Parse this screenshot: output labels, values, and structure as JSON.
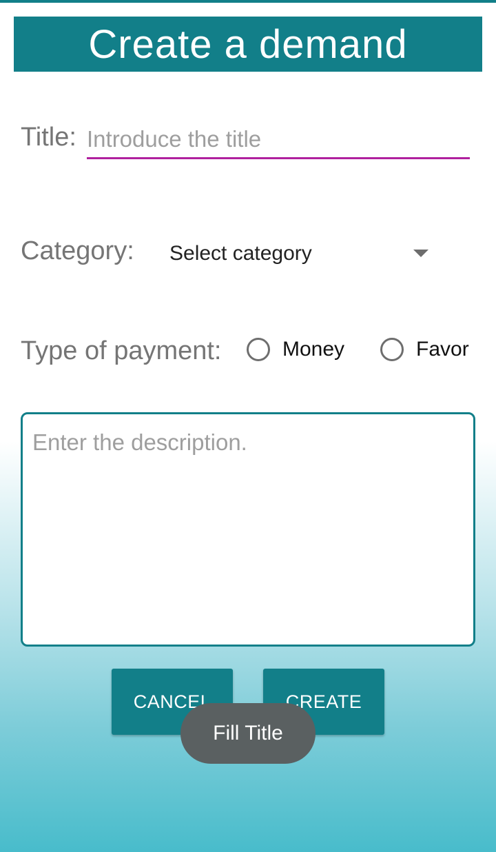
{
  "header": {
    "title": "Create a demand"
  },
  "form": {
    "title_label": "Title:",
    "title_placeholder": "Introduce the title",
    "title_value": "",
    "category_label": "Category:",
    "category_selected": "Select category",
    "payment_label": "Type of payment:",
    "payment_options": [
      {
        "label": "Money",
        "checked": false
      },
      {
        "label": "Favor",
        "checked": false
      }
    ],
    "description_placeholder": "Enter the description.",
    "description_value": ""
  },
  "buttons": {
    "cancel_label": "CANCEL",
    "create_label": "CREATE"
  },
  "toast": {
    "message": "Fill Title"
  },
  "colors": {
    "primary": "#127f89",
    "title_underline": "#b0209e",
    "toast_background": "#5a6061"
  },
  "icons": {
    "category_dropdown": "chevron-down-icon",
    "radio": "radio-unchecked-icon"
  }
}
